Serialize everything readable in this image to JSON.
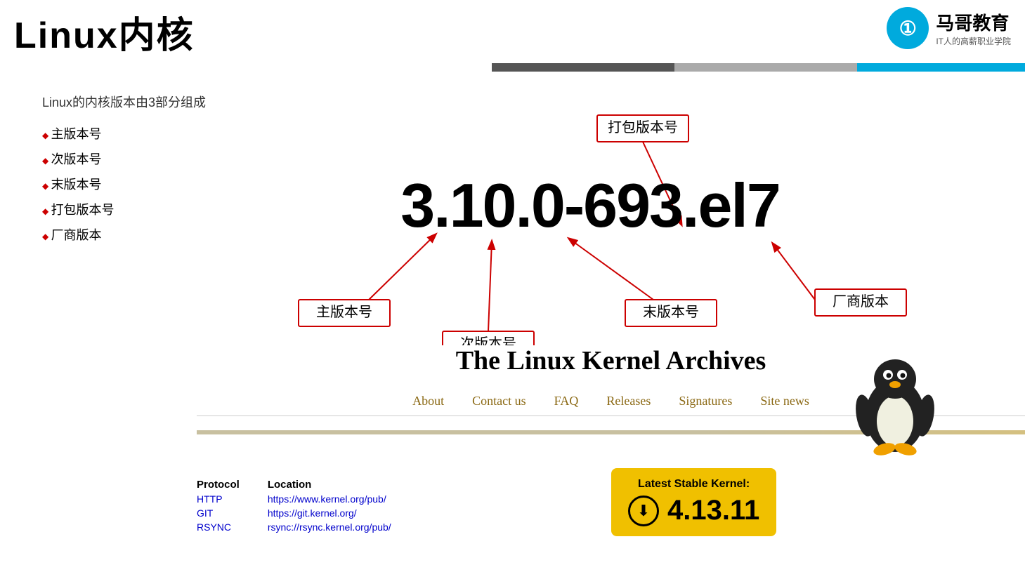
{
  "page": {
    "title": "Linux内核",
    "logo": {
      "name": "马哥教育",
      "sub": "IT人的高薪职业学院",
      "symbol": "①"
    }
  },
  "intro": {
    "description": "Linux的内核版本由3部分组成",
    "bullets": [
      "主版本号",
      "次版本号",
      "末版本号",
      "打包版本号",
      "厂商版本"
    ]
  },
  "version": {
    "display": "3.10.0-693.el7",
    "annotations": {
      "major": "主版本号",
      "minor": "次版本号",
      "patch": "末版本号",
      "package": "打包版本号",
      "vendor": "厂商版本"
    }
  },
  "kernel_archives": {
    "title": "The Linux Kernel Archives",
    "nav": [
      "About",
      "Contact us",
      "FAQ",
      "Releases",
      "Signatures",
      "Site news"
    ]
  },
  "protocol_table": {
    "col1_header": "Protocol",
    "col2_header": "Location",
    "rows": [
      {
        "protocol": "HTTP",
        "url": "https://www.kernel.org/pub/"
      },
      {
        "protocol": "GIT",
        "url": "https://git.kernel.org/"
      },
      {
        "protocol": "RSYNC",
        "url": "rsync://rsync.kernel.org/pub/"
      }
    ]
  },
  "latest_kernel": {
    "title": "Latest Stable Kernel:",
    "version": "4.13.11"
  }
}
